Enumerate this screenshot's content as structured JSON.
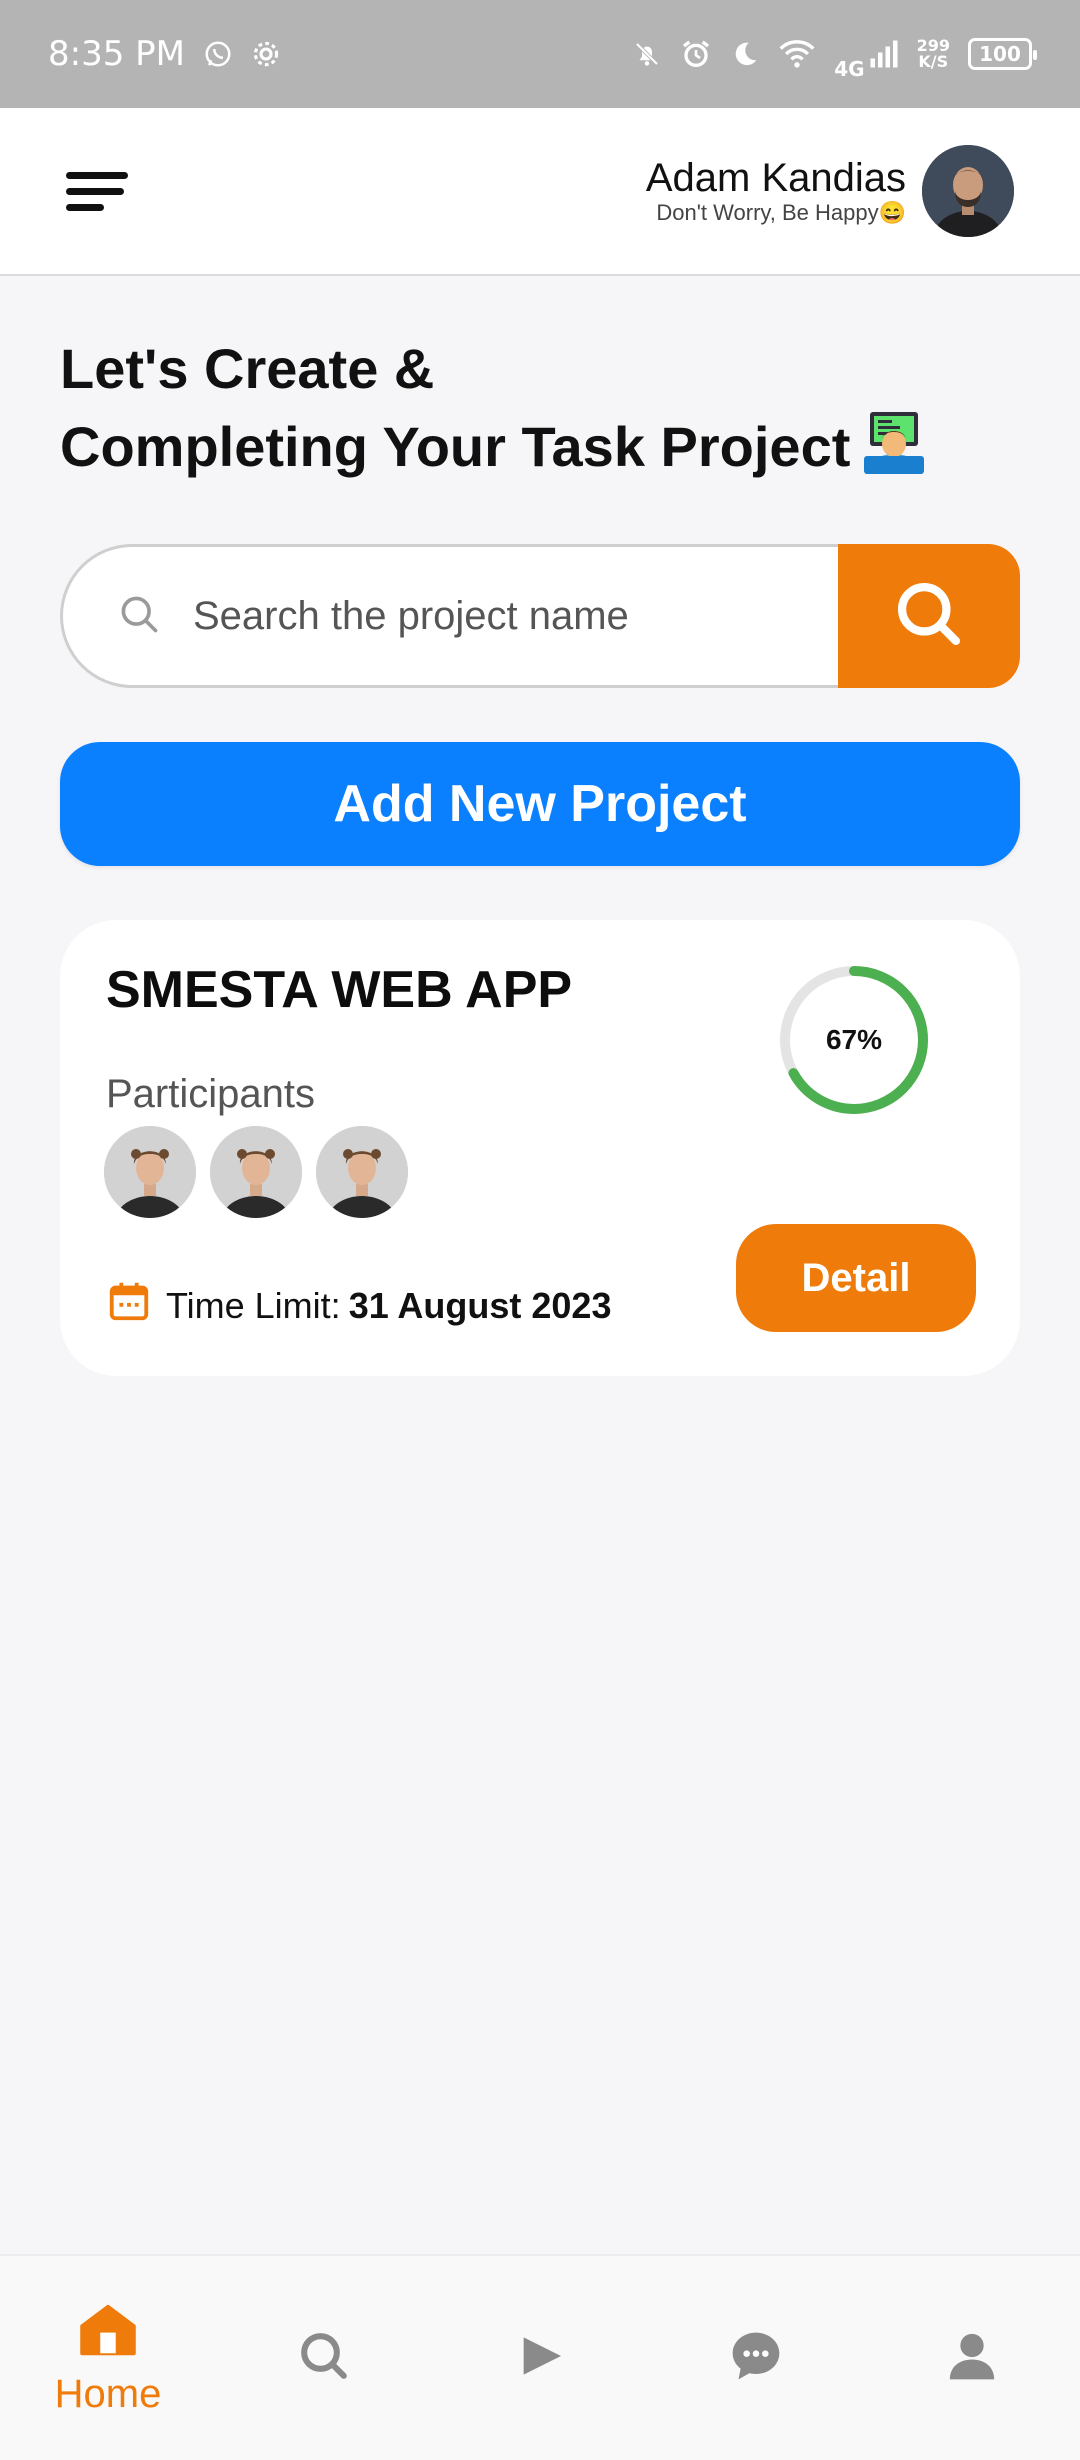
{
  "status_bar": {
    "time": "8:35 PM",
    "net_speed_value": "299",
    "net_speed_unit": "K/S",
    "network_type": "4G",
    "battery": "100"
  },
  "header": {
    "user_name": "Adam Kandias",
    "tagline": "Don't Worry, Be Happy😄"
  },
  "headline": {
    "line1": "Let's Create &",
    "line2": "Completing Your Task Project"
  },
  "search": {
    "placeholder": "Search the project name",
    "value": ""
  },
  "add_project_label": "Add New Project",
  "project": {
    "title": "SMESTA WEB APP",
    "participants_label": "Participants",
    "participant_count": 3,
    "progress_percent": 67,
    "progress_text": "67%",
    "time_limit_label": "Time Limit:",
    "time_limit_value": "31 August 2023",
    "detail_label": "Detail"
  },
  "bottom_nav": {
    "items": [
      {
        "icon": "home-icon",
        "label": "Home",
        "active": true
      },
      {
        "icon": "search-icon",
        "label": "",
        "active": false
      },
      {
        "icon": "play-icon",
        "label": "",
        "active": false
      },
      {
        "icon": "chat-icon",
        "label": "",
        "active": false
      },
      {
        "icon": "profile-icon",
        "label": "",
        "active": false
      }
    ]
  },
  "colors": {
    "accent_orange": "#ef7b0a",
    "primary_blue": "#0a80ff",
    "progress_green": "#4caf50",
    "inactive_icon": "#8a8a8a"
  }
}
